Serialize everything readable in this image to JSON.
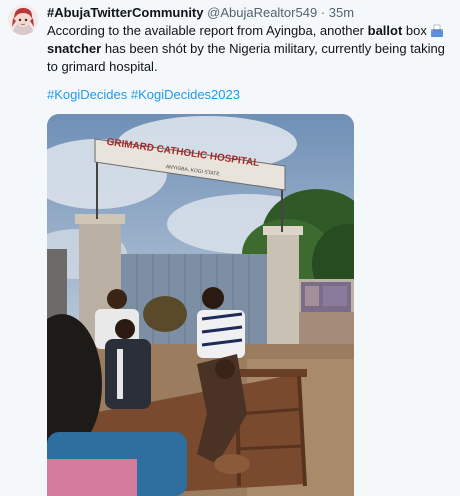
{
  "tweet": {
    "display_name": "#AbujaTwitterCommunity",
    "handle": "@AbujaRealtor549",
    "separator": "·",
    "time": "35m",
    "text_part1": "According to the available report from Ayingba, another ",
    "text_bold1": "ballot",
    "text_part2": " box ",
    "text_bold2": "snatcher",
    "text_part3": " has been shót by the Nigeria military, currently being taking to grimard hospital.",
    "hashtag1": "#KogiDecides",
    "hashtag2": "#KogiDecides2023"
  },
  "media": {
    "sign_title": "GRIMARD CATHOLIC HOSPITAL",
    "sign_subtitle": "ANYIGBA, KOGI STATE"
  },
  "colors": {
    "link": "#1d9bf0",
    "secondary_text": "#536471",
    "background": "#f5f8fa"
  }
}
